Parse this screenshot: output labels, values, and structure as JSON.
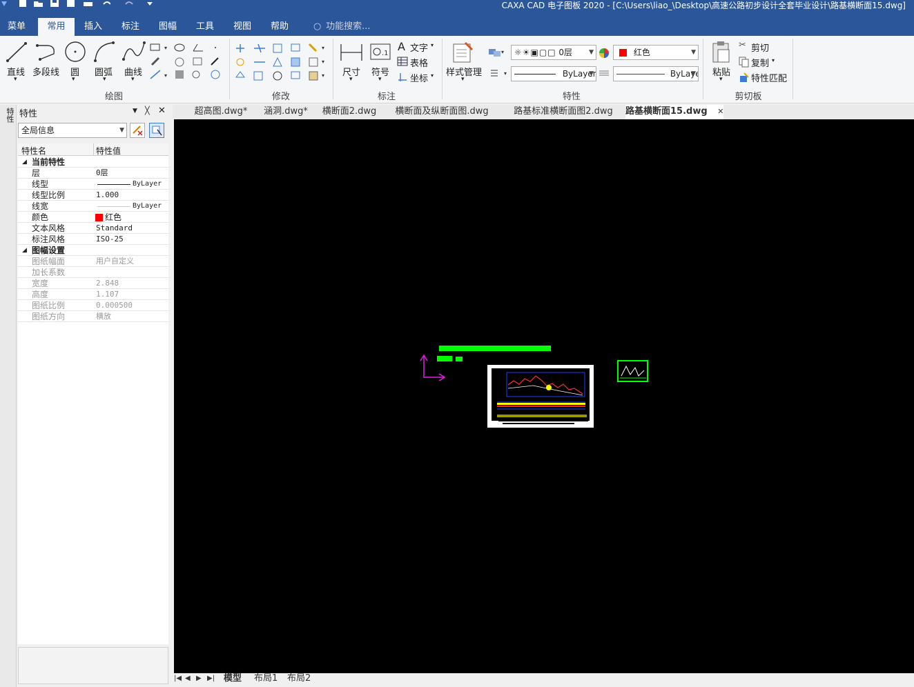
{
  "window": {
    "title": "CAXA CAD 电子图板 2020 - [C:\\Users\\liao_\\Desktop\\高速公路初步设计全套毕业设计\\路基横断面15.dwg]"
  },
  "menu": {
    "tabs": [
      "菜单",
      "常用",
      "插入",
      "标注",
      "图幅",
      "工具",
      "视图",
      "帮助"
    ],
    "active": "常用",
    "search_placeholder": "功能搜索..."
  },
  "ribbon": {
    "draw": {
      "label": "绘图",
      "tools": [
        "直线",
        "多段线",
        "圆",
        "圆弧",
        "曲线"
      ]
    },
    "modify": {
      "label": "修改"
    },
    "annotate": {
      "label": "标注",
      "tools": [
        "尺寸",
        "符号"
      ],
      "text": "文字",
      "table": "表格",
      "coord": "坐标"
    },
    "style_manager": "样式管理",
    "properties": {
      "label": "特性",
      "layer": "0层",
      "color": "红色",
      "linetype": "ByLayer",
      "lineweight": "ByLayer"
    },
    "clipboard": {
      "label": "剪切板",
      "paste": "粘贴",
      "cut": "剪切",
      "copy": "复制",
      "match": "特性匹配"
    }
  },
  "panel": {
    "title": "特性",
    "side_tab": "特性",
    "filter": "全局信息",
    "header": {
      "name": "特性名",
      "value": "特性值"
    },
    "sections": [
      {
        "title": "当前特性",
        "rows": [
          {
            "name": "层",
            "value": "0层"
          },
          {
            "name": "线型",
            "value": "ByLayer"
          },
          {
            "name": "线型比例",
            "value": "1.000"
          },
          {
            "name": "线宽",
            "value": "ByLayer"
          },
          {
            "name": "颜色",
            "value": "红色"
          },
          {
            "name": "文本风格",
            "value": "Standard"
          },
          {
            "name": "标注风格",
            "value": "ISO-25"
          }
        ]
      },
      {
        "title": "图幅设置",
        "rows": [
          {
            "name": "图纸幅面",
            "value": "用户自定义"
          },
          {
            "name": "加长系数",
            "value": ""
          },
          {
            "name": "宽度",
            "value": "2.848"
          },
          {
            "name": "高度",
            "value": "1.107"
          },
          {
            "name": "图纸比例",
            "value": "0.000500"
          },
          {
            "name": "图纸方向",
            "value": "横放"
          }
        ]
      }
    ]
  },
  "doc_tabs": [
    "超高图.dwg*",
    "涵洞.dwg*",
    "横断面2.dwg",
    "横断面及纵断面图.dwg",
    "路基标准横断面图2.dwg",
    "路基横断面15.dwg"
  ],
  "active_doc": "路基横断面15.dwg",
  "layout_tabs": [
    "模型",
    "布局1",
    "布局2"
  ],
  "colors": {
    "titlebar": "#2b579a",
    "canvas": "#000000",
    "accent_red": "#ff0000",
    "accent_green": "#00ff00",
    "ucs_magenta": "#e020e0"
  }
}
